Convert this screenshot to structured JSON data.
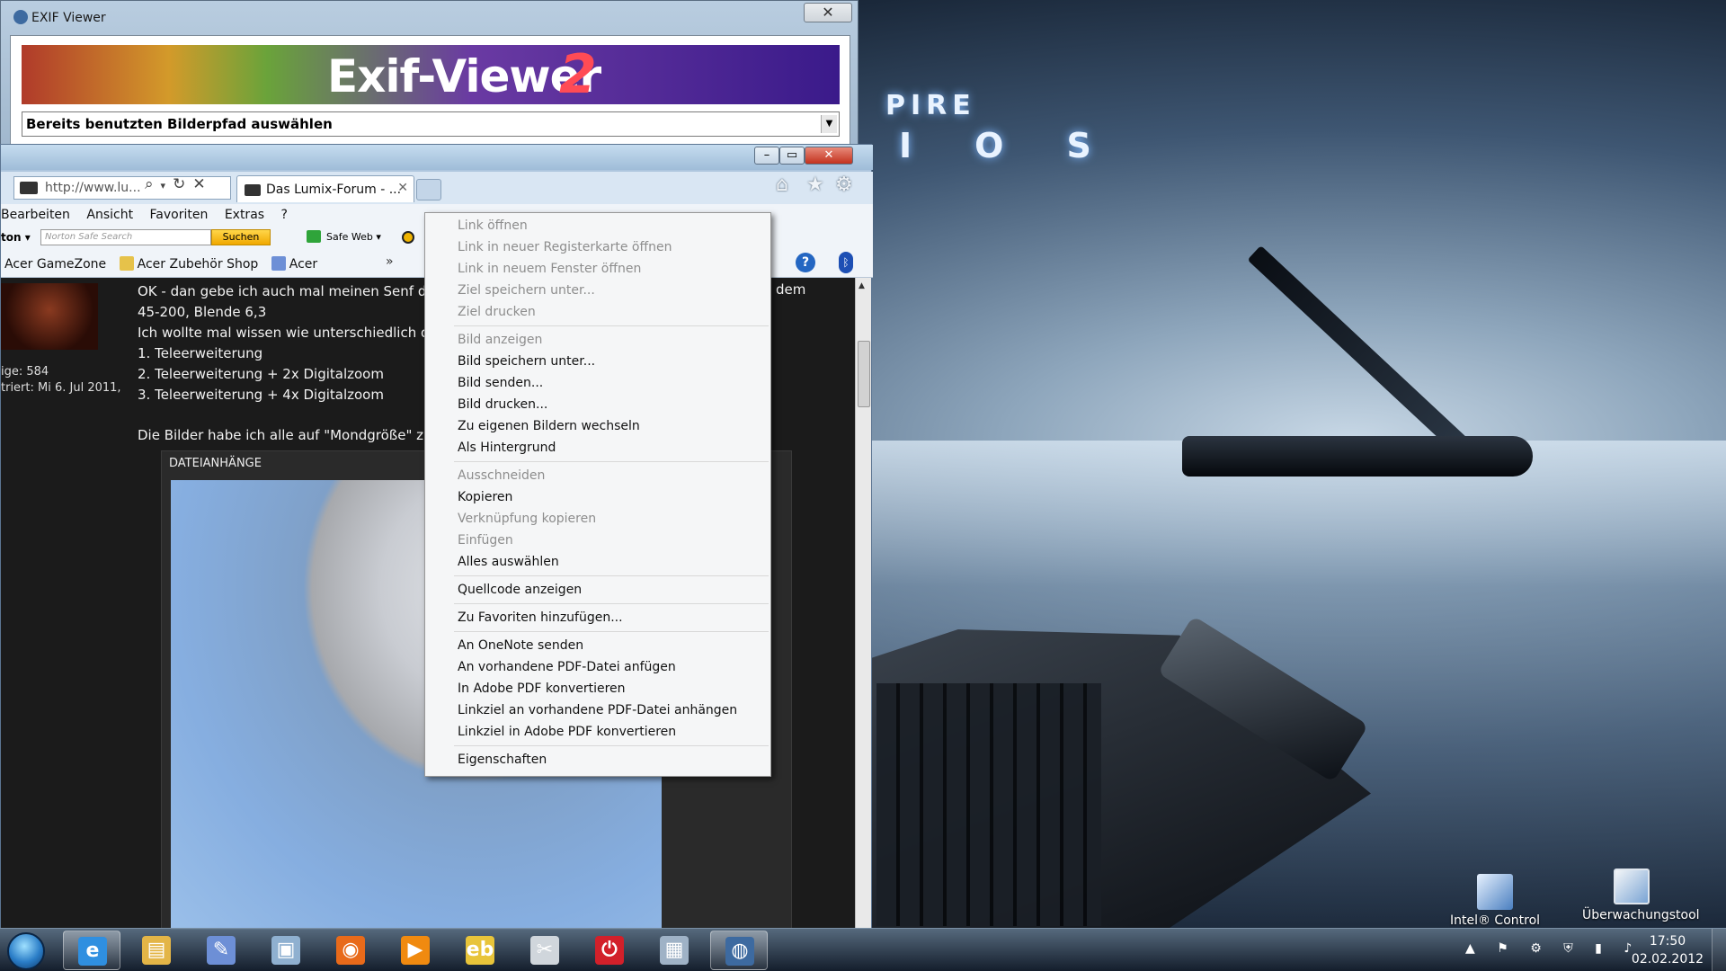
{
  "desktop": {
    "brand_top": "PIRE",
    "brand_bottom": "IOS",
    "icons": [
      {
        "label": "Intel® Control",
        "name": "intel-control-icon"
      },
      {
        "label": "Überwachungstool",
        "name": "monitoring-tool-icon"
      }
    ]
  },
  "exif_viewer": {
    "title": "EXIF Viewer",
    "close_label": "✕",
    "banner_title": "Exif-Viewer",
    "banner_version": "2",
    "path_select": "Bereits benutzten Bilderpfad auswählen"
  },
  "browser": {
    "address": "http://www.lu...",
    "tab_title": "Das Lumix-Forum - ...",
    "tab_close": "✕",
    "menu": [
      "Bearbeiten",
      "Ansicht",
      "Favoriten",
      "Extras",
      "?"
    ],
    "norton": {
      "label": "ton ▾",
      "search_placeholder": "Norton Safe Search",
      "search_button": "Suchen",
      "safe_web": "Safe Web ▾"
    },
    "favorites": [
      "Acer GameZone",
      "Acer Zubehör Shop",
      "Acer"
    ],
    "forum": {
      "side_posts": "ige: 584",
      "side_registered": "triert: Mi 6. Jul 2011,",
      "post_lines": [
        "OK - dan gebe ich auch mal meinen Senf da",
        "45-200, Blende 6,3",
        "Ich wollte mal wissen wie unterschiedlich d",
        "1. Teleerweiterung",
        "2. Teleerweiterung + 2x Digitalzoom",
        "3. Teleerweiterung + 4x Digitalzoom",
        "",
        "Die Bilder habe ich alle auf \"Mondgröße\" zur"
      ],
      "post_suffix": "dem",
      "attachments_header": "DATEIANHÄNGE"
    }
  },
  "context_menu": {
    "groups": [
      [
        {
          "label": "Link öffnen",
          "enabled": false
        },
        {
          "label": "Link in neuer Registerkarte öffnen",
          "enabled": false
        },
        {
          "label": "Link in neuem Fenster öffnen",
          "enabled": false
        },
        {
          "label": "Ziel speichern unter...",
          "enabled": false
        },
        {
          "label": "Ziel drucken",
          "enabled": false
        }
      ],
      [
        {
          "label": "Bild anzeigen",
          "enabled": false
        },
        {
          "label": "Bild speichern unter...",
          "enabled": true
        },
        {
          "label": "Bild senden...",
          "enabled": true
        },
        {
          "label": "Bild drucken...",
          "enabled": true
        },
        {
          "label": "Zu eigenen Bildern wechseln",
          "enabled": true
        },
        {
          "label": "Als Hintergrund",
          "enabled": true
        }
      ],
      [
        {
          "label": "Ausschneiden",
          "enabled": false
        },
        {
          "label": "Kopieren",
          "enabled": true
        },
        {
          "label": "Verknüpfung kopieren",
          "enabled": false
        },
        {
          "label": "Einfügen",
          "enabled": false
        },
        {
          "label": "Alles auswählen",
          "enabled": true
        }
      ],
      [
        {
          "label": "Quellcode anzeigen",
          "enabled": true
        }
      ],
      [
        {
          "label": "Zu Favoriten hinzufügen...",
          "enabled": true
        }
      ],
      [
        {
          "label": "An OneNote senden",
          "enabled": true
        },
        {
          "label": "An vorhandene PDF-Datei anfügen",
          "enabled": true
        },
        {
          "label": "In Adobe PDF konvertieren",
          "enabled": true
        },
        {
          "label": "Linkziel an vorhandene PDF-Datei anhängen",
          "enabled": true
        },
        {
          "label": "Linkziel in Adobe PDF konvertieren",
          "enabled": true
        }
      ],
      [
        {
          "label": "Eigenschaften",
          "enabled": true
        }
      ]
    ]
  },
  "taskbar": {
    "apps": [
      {
        "name": "internet-explorer-icon",
        "glyph": "e",
        "color": "#2f8fe0",
        "active": true
      },
      {
        "name": "explorer-folder-icon",
        "glyph": "▤",
        "color": "#e3b547",
        "active": false
      },
      {
        "name": "paint-tool-icon",
        "glyph": "✎",
        "color": "#6d8fd6",
        "active": false
      },
      {
        "name": "window-app-icon",
        "glyph": "▣",
        "color": "#8fb0d0",
        "active": false
      },
      {
        "name": "firefox-icon",
        "glyph": "◉",
        "color": "#e86a1a",
        "active": false
      },
      {
        "name": "media-player-icon",
        "glyph": "▶",
        "color": "#f08a10",
        "active": false
      },
      {
        "name": "ebay-icon",
        "glyph": "eb",
        "color": "#e8c43a",
        "active": false
      },
      {
        "name": "snipping-tool-icon",
        "glyph": "✂",
        "color": "#d0d6dc",
        "active": false
      },
      {
        "name": "power-icon",
        "glyph": "⏻",
        "color": "#d2202a",
        "active": false
      },
      {
        "name": "calculator-icon",
        "glyph": "▦",
        "color": "#9fb2c6",
        "active": false
      },
      {
        "name": "exif-viewer-task-icon",
        "glyph": "◍",
        "color": "#3d6aa0",
        "active": true
      }
    ],
    "tray_icons": "▲ ⚑ ⚙ ⛨ ▮ ♪",
    "time": "17:50",
    "date": "02.02.2012"
  }
}
